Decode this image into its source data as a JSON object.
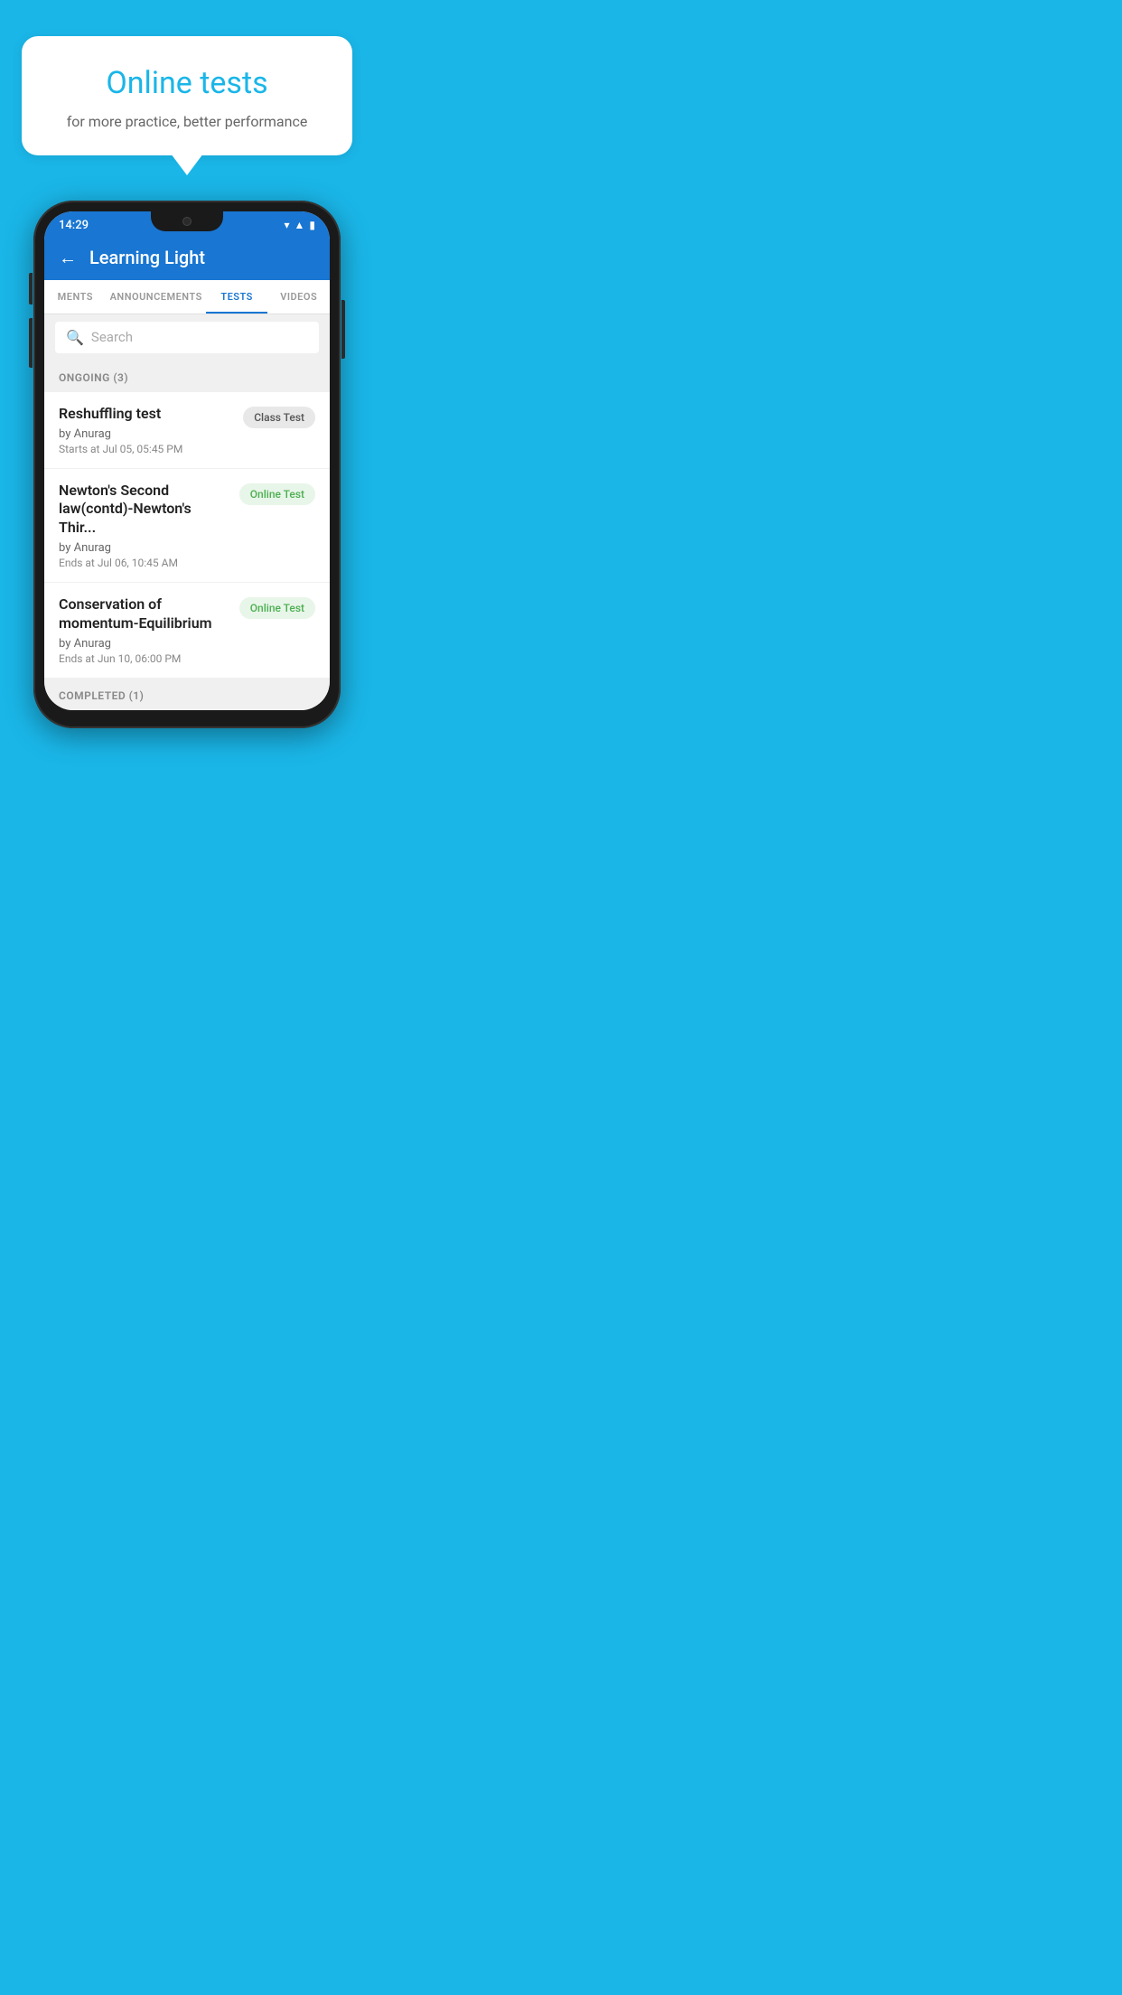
{
  "background_color": "#1ab6e8",
  "promo": {
    "title": "Online tests",
    "subtitle": "for more practice, better performance"
  },
  "phone": {
    "status_bar": {
      "time": "14:29",
      "icons": [
        "wifi",
        "signal",
        "battery"
      ]
    },
    "header": {
      "title": "Learning Light",
      "back_label": "←"
    },
    "tabs": [
      {
        "label": "MENTS",
        "active": false
      },
      {
        "label": "ANNOUNCEMENTS",
        "active": false
      },
      {
        "label": "TESTS",
        "active": true
      },
      {
        "label": "VIDEOS",
        "active": false
      }
    ],
    "search": {
      "placeholder": "Search"
    },
    "ongoing_section": {
      "label": "ONGOING (3)"
    },
    "tests": [
      {
        "name": "Reshuffling test",
        "by": "by Anurag",
        "time": "Starts at  Jul 05, 05:45 PM",
        "badge": "Class Test",
        "badge_type": "class"
      },
      {
        "name": "Newton's Second law(contd)-Newton's Thir...",
        "by": "by Anurag",
        "time": "Ends at  Jul 06, 10:45 AM",
        "badge": "Online Test",
        "badge_type": "online"
      },
      {
        "name": "Conservation of momentum-Equilibrium",
        "by": "by Anurag",
        "time": "Ends at  Jun 10, 06:00 PM",
        "badge": "Online Test",
        "badge_type": "online"
      }
    ],
    "completed_section": {
      "label": "COMPLETED (1)"
    }
  }
}
